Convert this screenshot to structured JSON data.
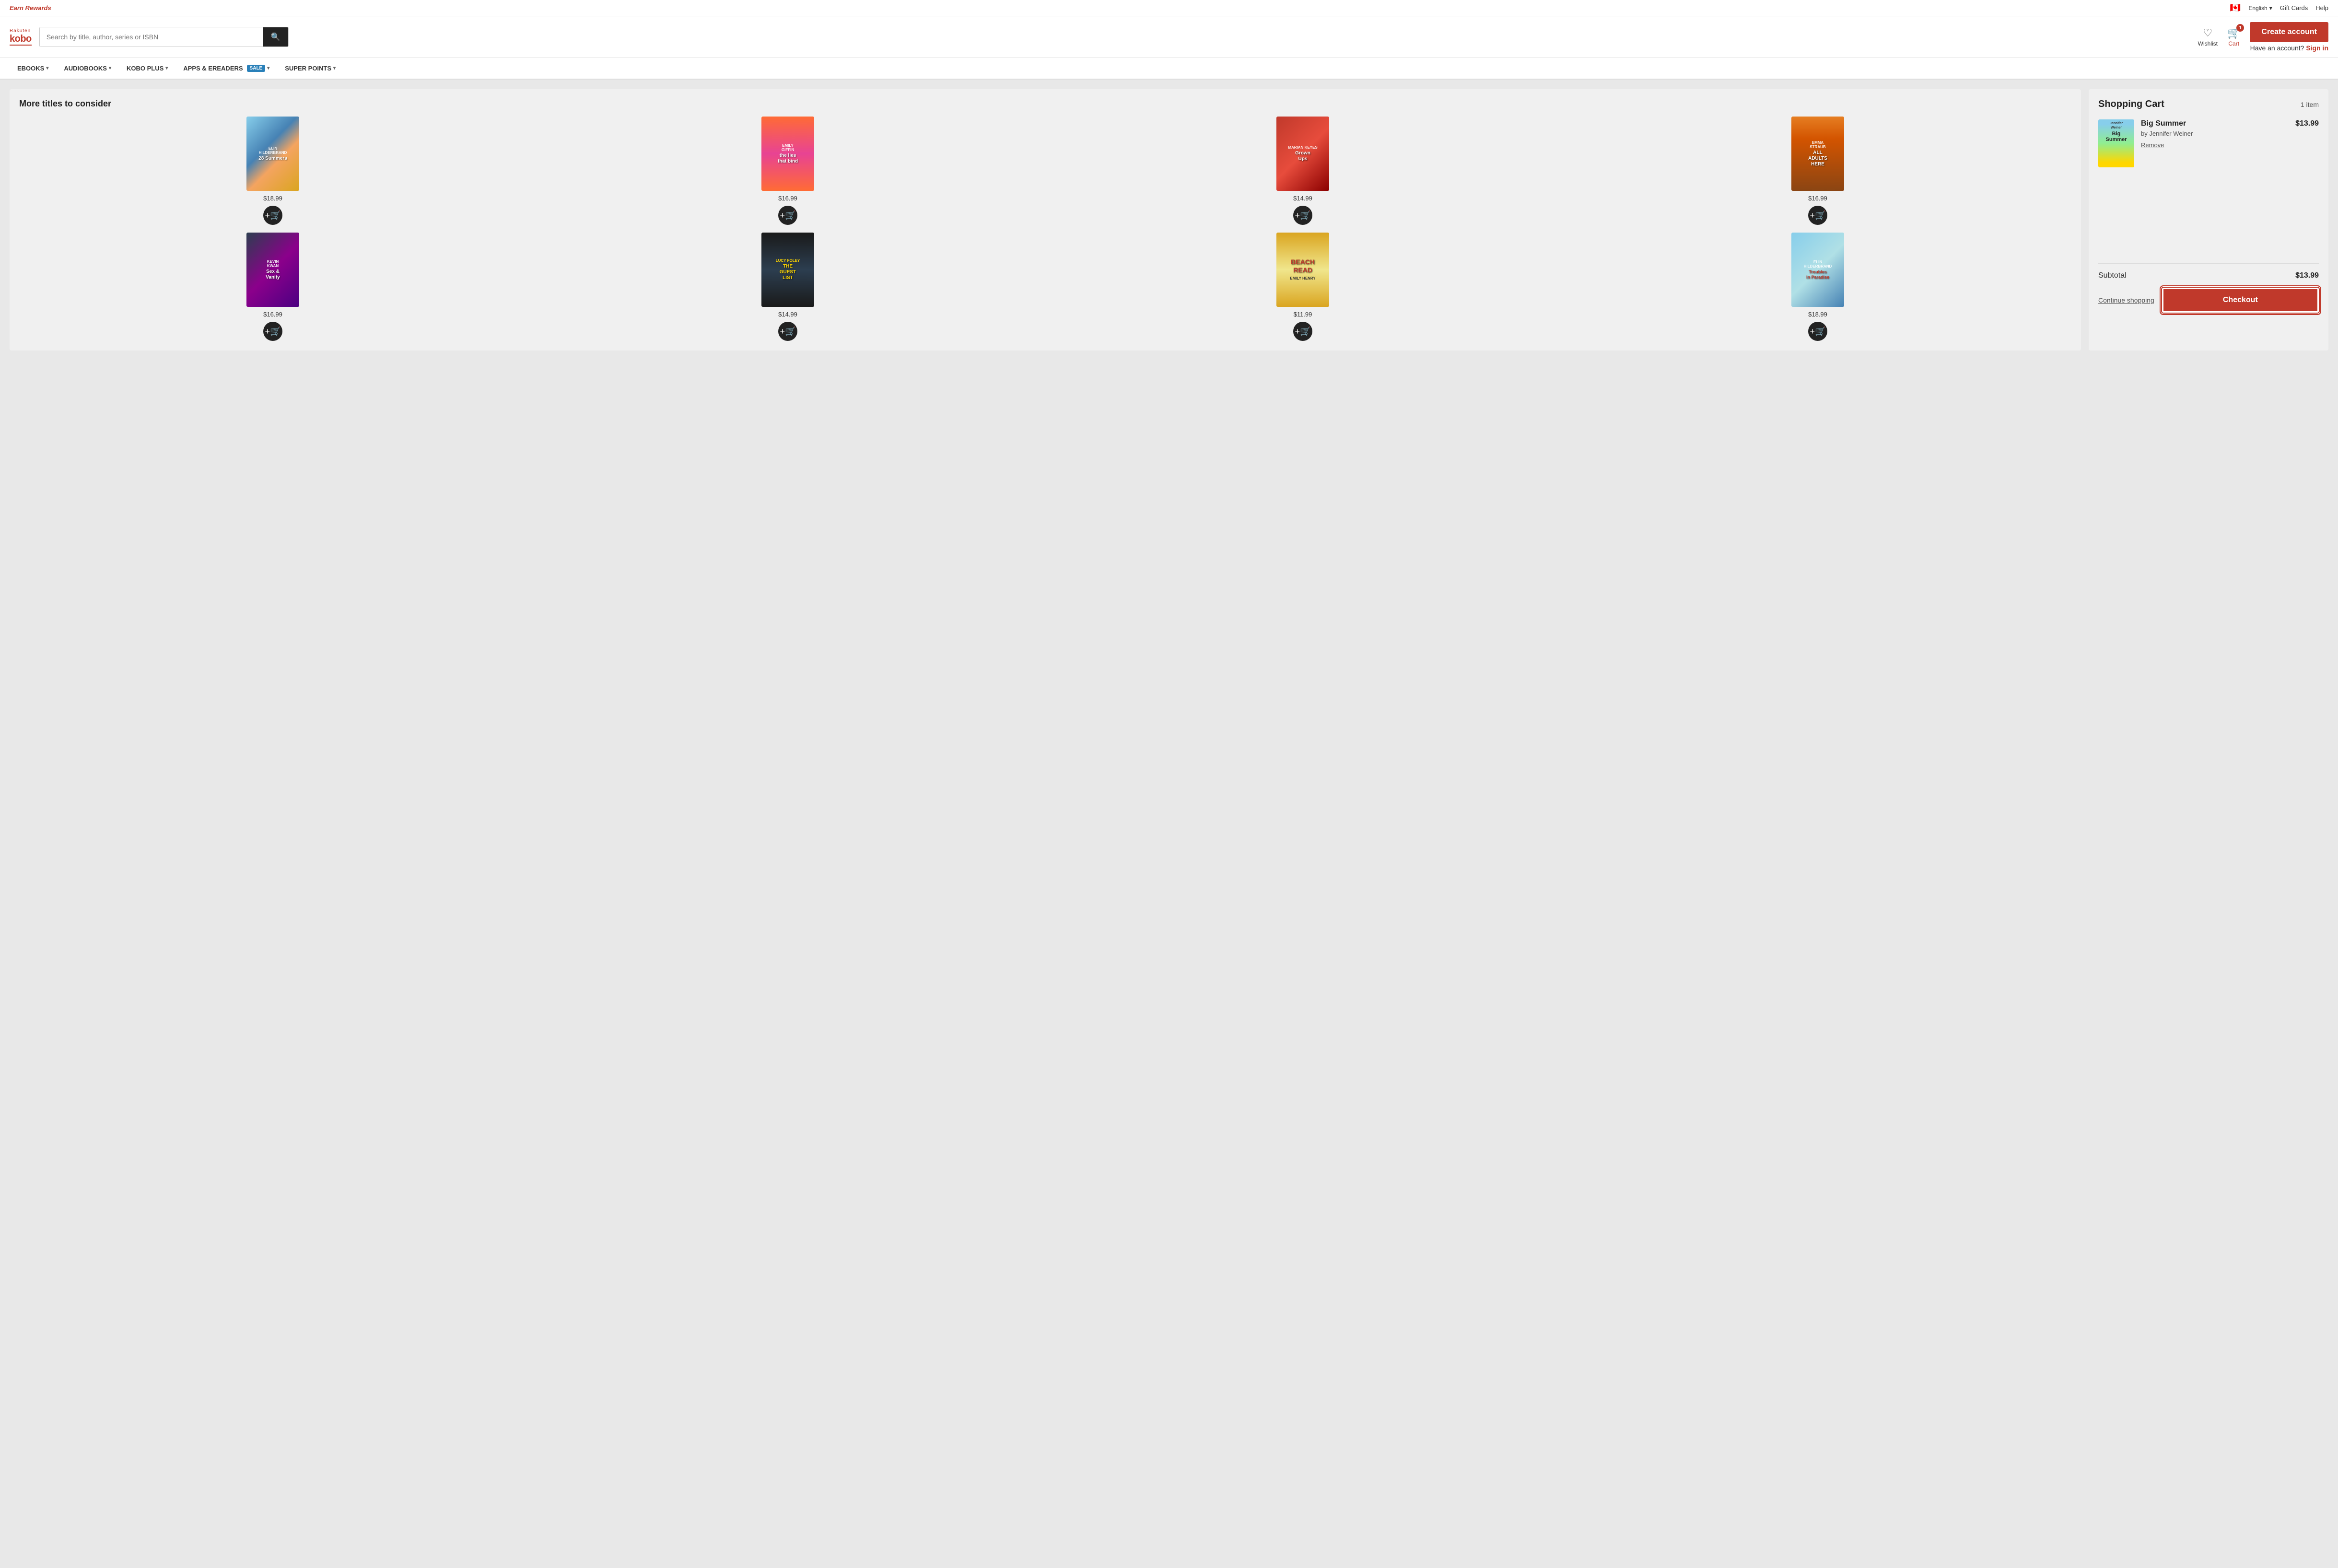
{
  "topbar": {
    "earn_rewards": "Earn Rewards",
    "flag": "🇨🇦",
    "language": "English",
    "chevron": "▾",
    "gift_cards": "Gift Cards",
    "help": "Help"
  },
  "header": {
    "logo_line1": "Rakuten",
    "logo_line2": "kobo",
    "search_placeholder": "Search by title, author, series or ISBN",
    "search_icon": "🔍",
    "wishlist_label": "Wishlist",
    "cart_label": "Cart",
    "cart_count": "1",
    "create_account": "Create account",
    "have_account": "Have an account?",
    "sign_in": "Sign in"
  },
  "nav": {
    "items": [
      {
        "label": "eBOOKS",
        "has_dropdown": true
      },
      {
        "label": "AUDIOBOOKS",
        "has_dropdown": true
      },
      {
        "label": "KOBO PLUS",
        "has_dropdown": true
      },
      {
        "label": "APPS & eREADERS",
        "has_dropdown": true,
        "badge": "SALE"
      },
      {
        "label": "SUPER POINTS",
        "has_dropdown": true
      }
    ]
  },
  "left_panel": {
    "section_title": "More titles to consider",
    "books": [
      {
        "id": 1,
        "author": "Elin Hilderbrand",
        "title": "28 Summers",
        "price": "$18.99",
        "cover_class": "cover-1"
      },
      {
        "id": 2,
        "author": "Emily Giffin",
        "title": "the lies that bind",
        "price": "$16.99",
        "cover_class": "cover-2"
      },
      {
        "id": 3,
        "author": "marian keyes",
        "title": "Grown Ups",
        "price": "$14.99",
        "cover_class": "cover-3"
      },
      {
        "id": 4,
        "author": "Emma Straub",
        "title": "ALL ADULTS HERE",
        "price": "$16.99",
        "cover_class": "cover-4"
      },
      {
        "id": 5,
        "author": "Kevin Kwan",
        "title": "Sex and Vanity",
        "price": "$16.99",
        "cover_class": "cover-5"
      },
      {
        "id": 6,
        "author": "Lucy Foley",
        "title": "The Guest List",
        "price": "$14.99",
        "cover_class": "cover-6"
      },
      {
        "id": 7,
        "author": "Emily Henry",
        "title": "Beach Read",
        "price": "$11.99",
        "cover_class": "cover-7"
      },
      {
        "id": 8,
        "author": "Elin Hilderbrand",
        "title": "Troubles in Paradise",
        "price": "$18.99",
        "cover_class": "cover-8"
      }
    ],
    "add_to_cart_icon": "+"
  },
  "right_panel": {
    "cart_title": "Shopping Cart",
    "cart_count": "1 item",
    "item": {
      "title": "Big Summer",
      "author": "by Jennifer Weiner",
      "price": "$13.99",
      "remove_label": "Remove"
    },
    "subtotal_label": "Subtotal",
    "subtotal_amount": "$13.99",
    "continue_shopping": "Continue shopping",
    "checkout": "Checkout"
  }
}
